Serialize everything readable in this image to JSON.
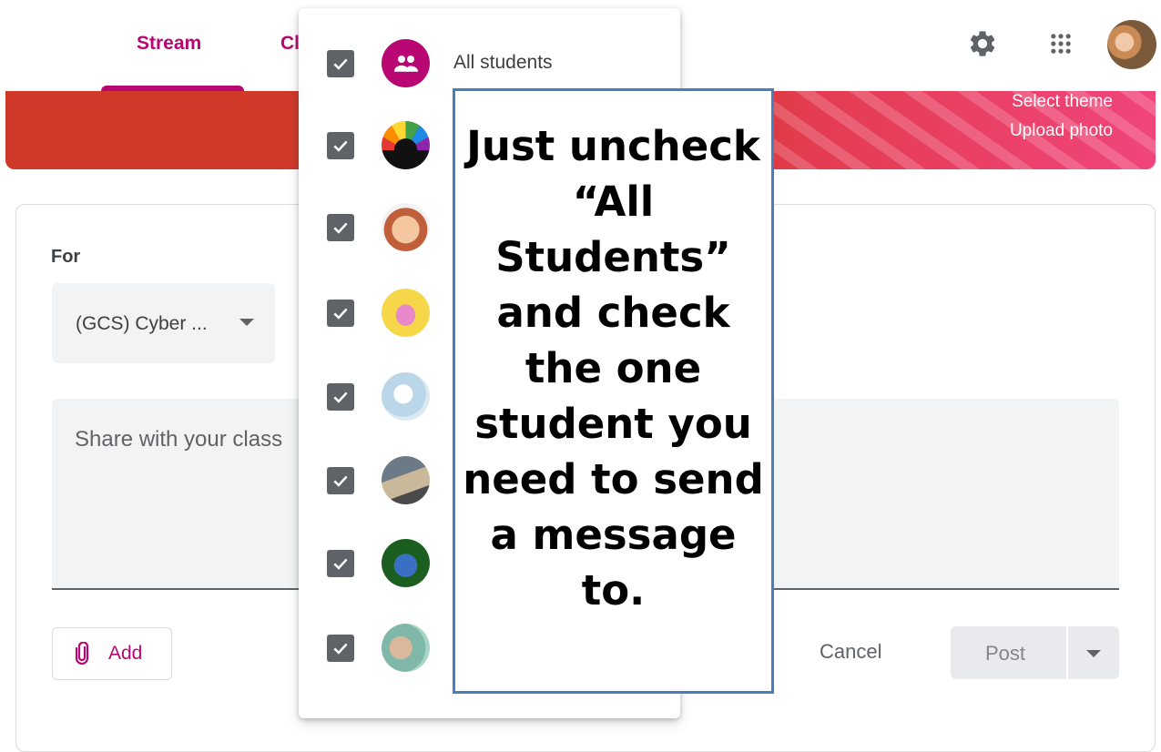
{
  "header": {
    "tabs": [
      {
        "label": "Stream",
        "active": true
      },
      {
        "label": "Cl"
      }
    ],
    "icons": [
      "gear-icon",
      "apps-grid-icon",
      "user-avatar"
    ]
  },
  "banner": {
    "select_theme": "Select theme",
    "upload_photo": "Upload photo"
  },
  "post_form": {
    "for_label": "For",
    "class_select_value": "(GCS) Cyber ...",
    "share_placeholder": "Share with your class",
    "add_label": "Add",
    "cancel_label": "Cancel",
    "post_label": "Post"
  },
  "recipients_dropdown": {
    "all_students_label": "All students",
    "rows": [
      {
        "type": "all-students",
        "checked": true
      },
      {
        "type": "student",
        "checked": true
      },
      {
        "type": "student",
        "checked": true
      },
      {
        "type": "student",
        "checked": true
      },
      {
        "type": "student",
        "checked": true
      },
      {
        "type": "student",
        "checked": true
      },
      {
        "type": "student",
        "checked": true
      },
      {
        "type": "student",
        "checked": true
      }
    ]
  },
  "callout": {
    "text": "Just uncheck “All Students” and check the one student you need to send a message to."
  },
  "colors": {
    "accent": "#b80672",
    "banner_red": "#d0392a",
    "callout_border": "#4a7ebb"
  }
}
